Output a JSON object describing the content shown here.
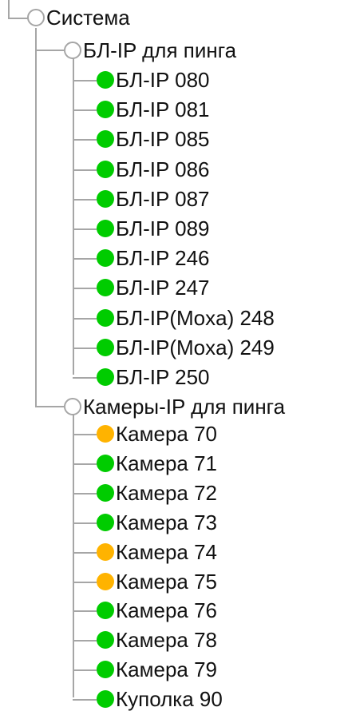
{
  "colors": {
    "ok": "#00cc00",
    "warning": "#ffb300",
    "neutral": "#a6a6a6"
  },
  "tree": {
    "root": {
      "label": "Система",
      "status": "neutral",
      "groups": [
        {
          "label": "БЛ-IP для пинга",
          "status": "neutral",
          "items": [
            {
              "label": "БЛ-IP 080",
              "status": "ok"
            },
            {
              "label": "БЛ-IP 081",
              "status": "ok"
            },
            {
              "label": "БЛ-IP 085",
              "status": "ok"
            },
            {
              "label": "БЛ-IP 086",
              "status": "ok"
            },
            {
              "label": "БЛ-IP 087",
              "status": "ok"
            },
            {
              "label": "БЛ-IP 089",
              "status": "ok"
            },
            {
              "label": "БЛ-IP 246",
              "status": "ok"
            },
            {
              "label": "БЛ-IP 247",
              "status": "ok"
            },
            {
              "label": "БЛ-IP(Moxa) 248",
              "status": "ok"
            },
            {
              "label": "БЛ-IP(Moxa) 249",
              "status": "ok"
            },
            {
              "label": "БЛ-IP 250",
              "status": "ok"
            }
          ]
        },
        {
          "label": "Камеры-IP для пинга",
          "status": "neutral",
          "items": [
            {
              "label": "Камера 70",
              "status": "warning"
            },
            {
              "label": "Камера 71",
              "status": "ok"
            },
            {
              "label": "Камера 72",
              "status": "ok"
            },
            {
              "label": "Камера 73",
              "status": "ok"
            },
            {
              "label": "Камера 74",
              "status": "warning"
            },
            {
              "label": "Камера 75",
              "status": "warning"
            },
            {
              "label": "Камера 76",
              "status": "ok"
            },
            {
              "label": "Камера 78",
              "status": "ok"
            },
            {
              "label": "Камера 79",
              "status": "ok"
            },
            {
              "label": "Куполка 90",
              "status": "ok"
            }
          ]
        }
      ]
    }
  }
}
